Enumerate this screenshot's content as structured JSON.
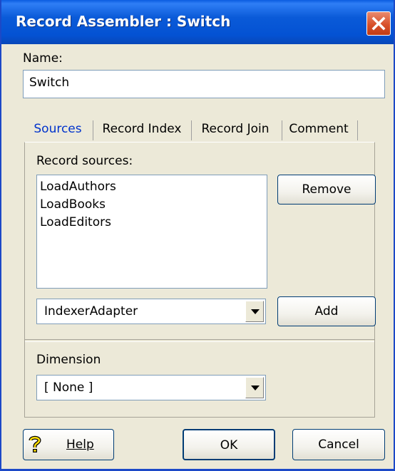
{
  "window": {
    "title": "Record Assembler :  Switch",
    "close_icon": "close-x-icon"
  },
  "name_field": {
    "label": "Name:",
    "value": "Switch"
  },
  "tabs": [
    {
      "label": "Sources",
      "active": true
    },
    {
      "label": "Record Index",
      "active": false
    },
    {
      "label": "Record Join",
      "active": false
    },
    {
      "label": "Comment",
      "active": false
    }
  ],
  "sources": {
    "label": "Record sources:",
    "items": [
      "LoadAuthors",
      "LoadBooks",
      "LoadEditors"
    ],
    "remove_button": "Remove",
    "adapter_select": "IndexerAdapter",
    "add_button": "Add"
  },
  "dimension": {
    "label": "Dimension",
    "value": "[ None ]"
  },
  "footer": {
    "help_button": "Help",
    "help_icon": "help-question-icon",
    "ok_button": "OK",
    "cancel_button": "Cancel"
  },
  "colors": {
    "titlebar": "#0452d3",
    "close_button": "#d8512b",
    "dialog_bg": "#ece9d8",
    "active_tab_text": "#0033cc"
  }
}
